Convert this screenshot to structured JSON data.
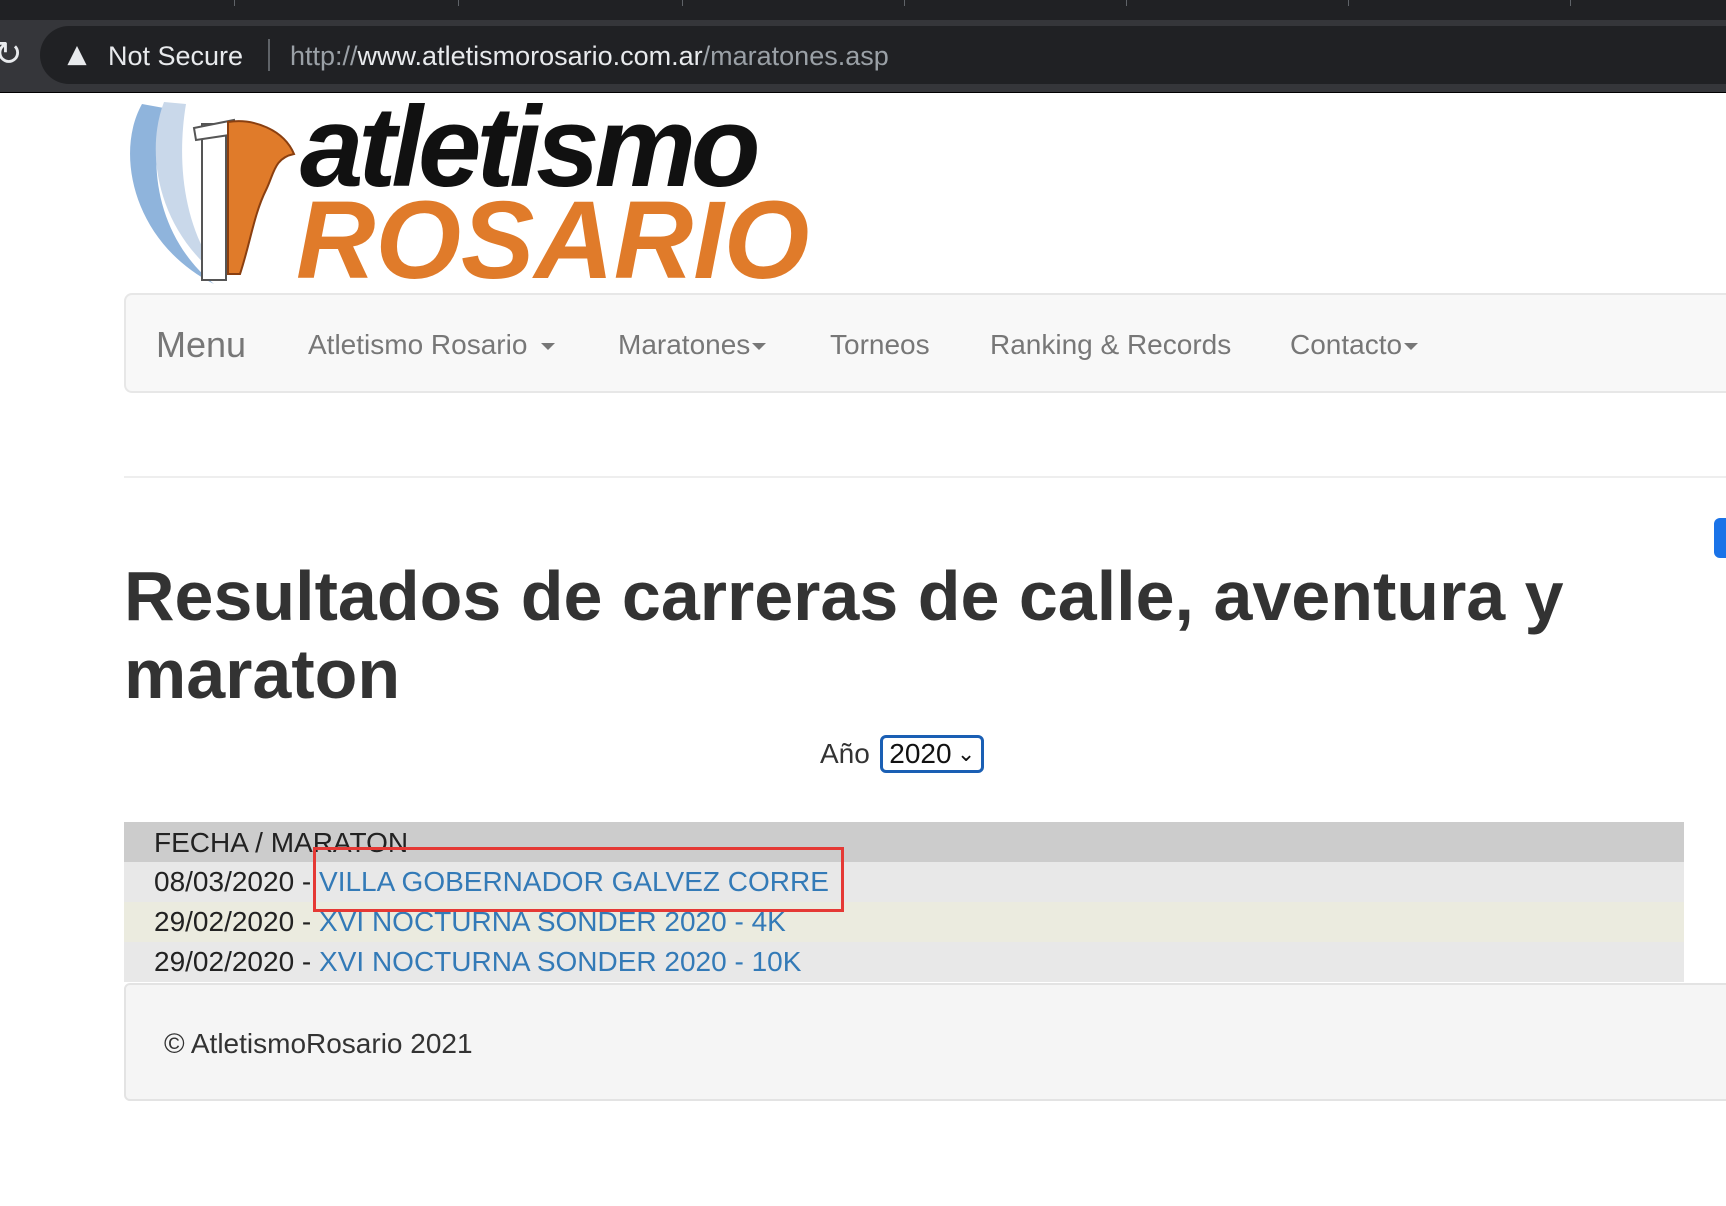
{
  "browser": {
    "security_label": "Not Secure",
    "url_scheme": "http://",
    "url_host": "www.atletismorosario.com.ar",
    "url_path": "/maratones.asp"
  },
  "logo": {
    "line1": "atletismo",
    "line2": "ROSARIO"
  },
  "nav": {
    "brand": "Menu",
    "items": [
      {
        "label": "Atletismo Rosario",
        "dropdown": true
      },
      {
        "label": "Maratones",
        "dropdown": true
      },
      {
        "label": "Torneos",
        "dropdown": false
      },
      {
        "label": "Ranking & Records",
        "dropdown": false
      },
      {
        "label": "Contacto",
        "dropdown": true
      }
    ]
  },
  "page": {
    "title": "Resultados de carreras de calle, aventura y maraton"
  },
  "year_filter": {
    "label": "Año",
    "selected": "2020"
  },
  "results": {
    "header": "FECHA / MARATON",
    "rows": [
      {
        "date": "08/03/2020",
        "separator": " - ",
        "name": "VILLA GOBERNADOR GALVEZ CORRE"
      },
      {
        "date": "29/02/2020",
        "separator": " - ",
        "name": "XVI NOCTURNA SONDER 2020 - 4K"
      },
      {
        "date": "29/02/2020",
        "separator": " - ",
        "name": "XVI NOCTURNA SONDER 2020 - 10K"
      }
    ]
  },
  "footer": {
    "text": "© AtletismoRosario 2021"
  },
  "colors": {
    "link": "#337ab7",
    "logo_orange": "#e07b2a",
    "highlight_box": "#e53935"
  }
}
